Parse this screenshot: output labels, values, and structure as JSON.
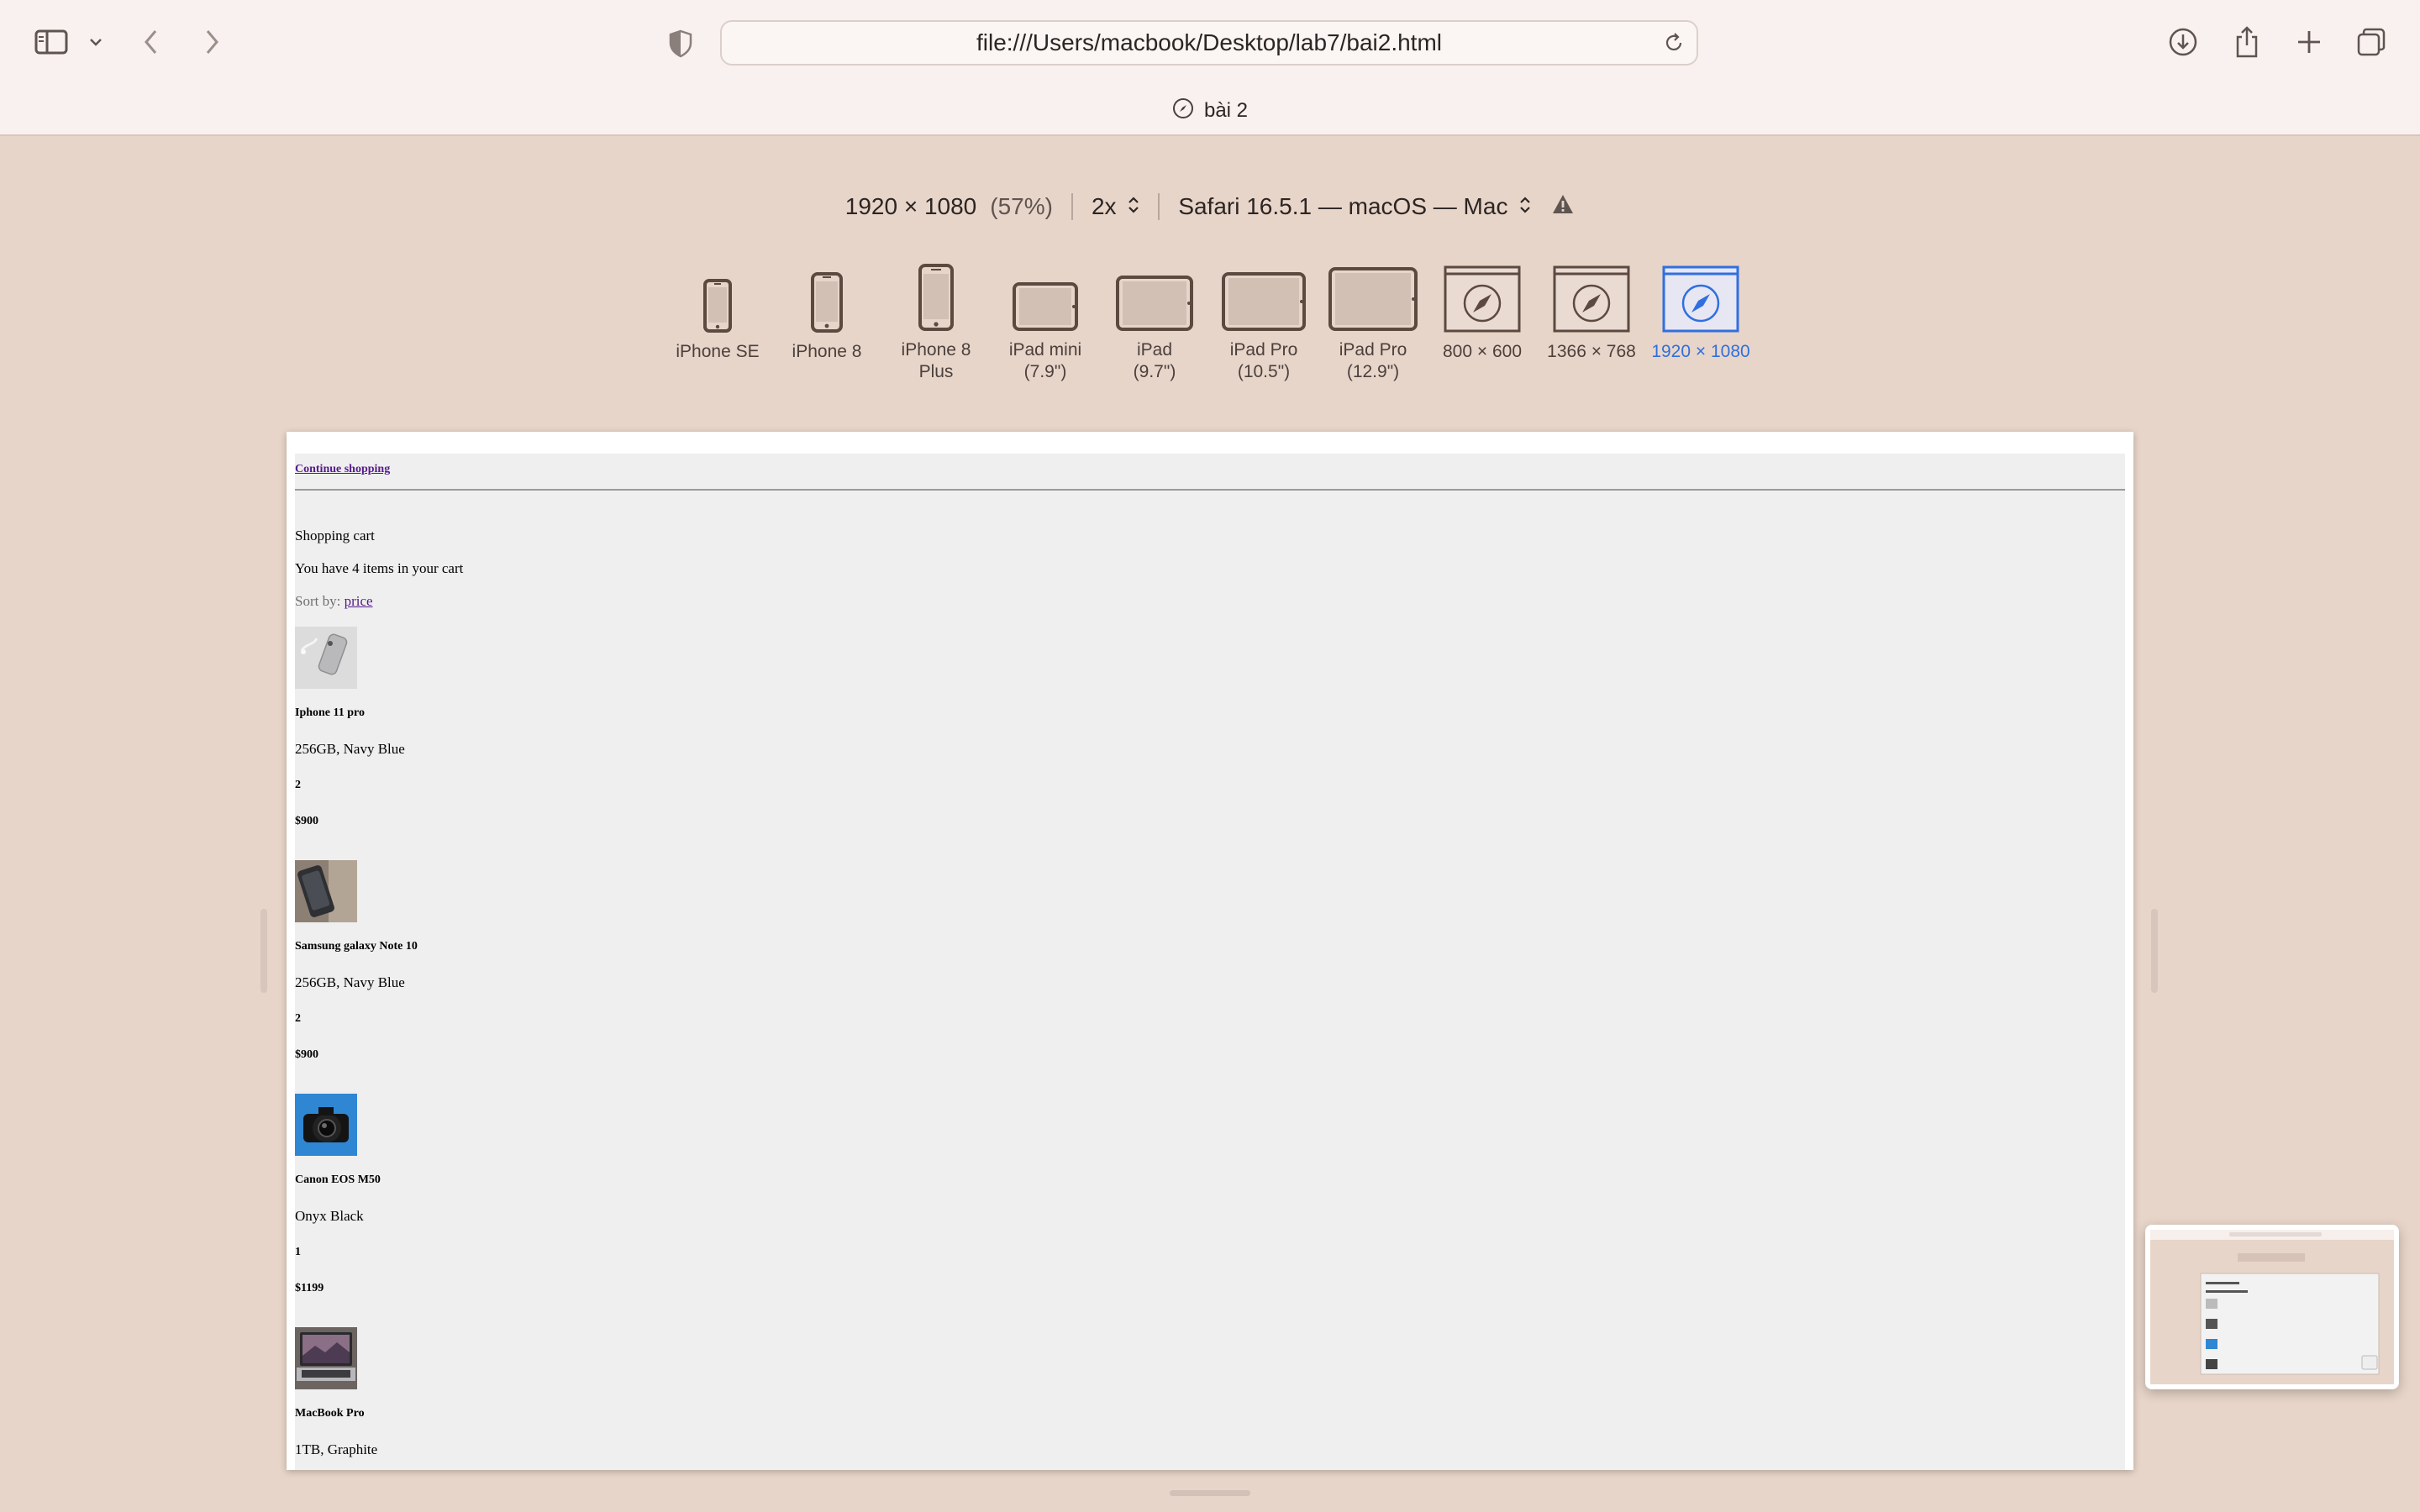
{
  "browser": {
    "url": "file:///Users/macbook/Desktop/lab7/bai2.html",
    "tab_title": "bài 2"
  },
  "responsive_bar": {
    "resolution": "1920 × 1080",
    "zoom": "(57%)",
    "scale": "2x",
    "user_agent": "Safari 16.5.1 — macOS — Mac",
    "devices": [
      {
        "label": "iPhone SE",
        "icon": "phone-small-icon",
        "active": false
      },
      {
        "label": "iPhone 8",
        "icon": "phone-icon",
        "active": false
      },
      {
        "label": "iPhone 8\nPlus",
        "icon": "phone-large-icon",
        "active": false
      },
      {
        "label": "iPad mini\n(7.9\")",
        "icon": "tablet-small-icon",
        "active": false
      },
      {
        "label": "iPad\n(9.7\")",
        "icon": "tablet-icon",
        "active": false
      },
      {
        "label": "iPad Pro\n(10.5\")",
        "icon": "tablet-pro-icon",
        "active": false
      },
      {
        "label": "iPad Pro\n(12.9\")",
        "icon": "tablet-pro-large-icon",
        "active": false
      },
      {
        "label": "800 × 600",
        "icon": "safari-window-icon",
        "active": false
      },
      {
        "label": "1366 × 768",
        "icon": "safari-window-icon",
        "active": false
      },
      {
        "label": "1920 × 1080",
        "icon": "safari-window-icon",
        "active": true
      }
    ],
    "active_color": "#2f6fe0"
  },
  "page": {
    "continue_link": "Continue shopping",
    "heading": "Shopping cart",
    "summary": "You have 4 items in your cart",
    "sort_label": "Sort by:",
    "sort_link": "price",
    "items": [
      {
        "name": "Iphone 11 pro",
        "variant": "256GB, Navy Blue",
        "quantity": "2",
        "price": "$900",
        "image": "iphone-photo"
      },
      {
        "name": "Samsung galaxy Note 10",
        "variant": "256GB, Navy Blue",
        "quantity": "2",
        "price": "$900",
        "image": "samsung-photo"
      },
      {
        "name": "Canon EOS M50",
        "variant": "Onyx Black",
        "quantity": "1",
        "price": "$1199",
        "image": "camera-photo"
      },
      {
        "name": "MacBook Pro",
        "variant": "1TB, Graphite",
        "image": "macbook-photo"
      }
    ]
  }
}
